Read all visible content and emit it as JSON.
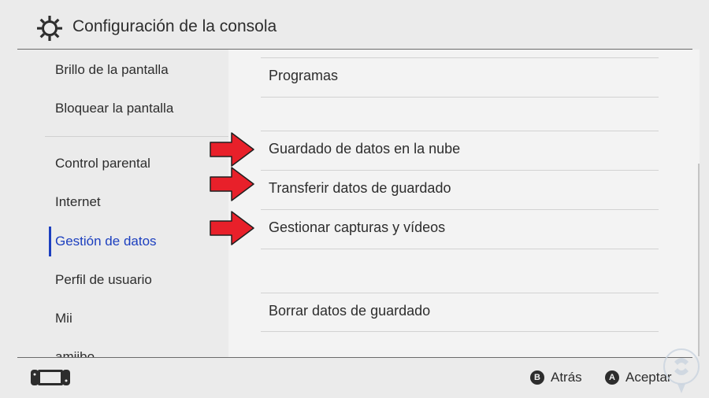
{
  "header": {
    "title": "Configuración de la consola",
    "icon": "gear-icon"
  },
  "sidebar": {
    "items": [
      {
        "label": "Brillo de la pantalla"
      },
      {
        "label": "Bloquear la pantalla"
      },
      {
        "label": "Control parental"
      },
      {
        "label": "Internet"
      },
      {
        "label": "Gestión de datos",
        "active": true
      },
      {
        "label": "Perfil de usuario"
      },
      {
        "label": "Mii"
      },
      {
        "label": "amiibo"
      }
    ]
  },
  "main": {
    "options": [
      {
        "label": "Programas"
      },
      {
        "label": "Guardado de datos en la nube"
      },
      {
        "label": "Transferir datos de guardado"
      },
      {
        "label": "Gestionar capturas y vídeos"
      },
      {
        "label": "Borrar datos de guardado"
      }
    ]
  },
  "footer": {
    "back": {
      "button": "B",
      "label": "Atrás"
    },
    "accept": {
      "button": "A",
      "label": "Aceptar"
    },
    "console_icon": "console-icon"
  },
  "colors": {
    "accent": "#1c3fbf",
    "arrow": "#e8202a",
    "background": "#ebebeb",
    "panel": "#f3f3f3"
  }
}
